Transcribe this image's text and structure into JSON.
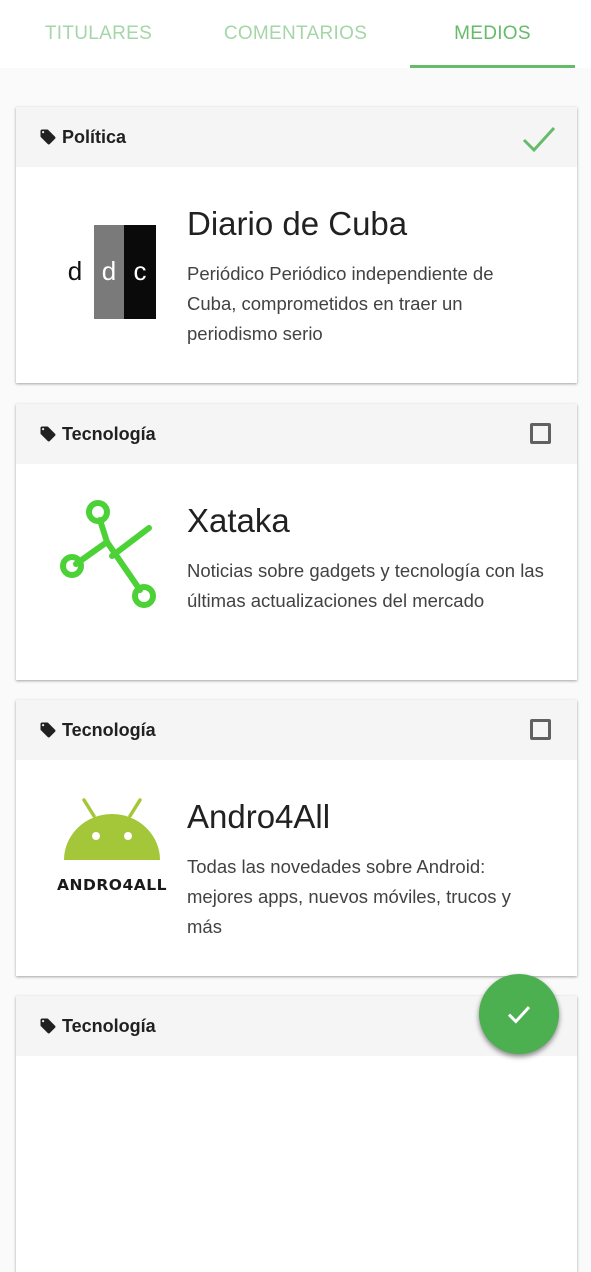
{
  "tabs": [
    {
      "label": "TITULARES",
      "active": false
    },
    {
      "label": "COMENTARIOS",
      "active": false
    },
    {
      "label": "MEDIOS",
      "active": true
    }
  ],
  "colors": {
    "accent": "#66bb6a",
    "fab": "#4caf50",
    "header_bg": "#f5f5f5"
  },
  "cards": [
    {
      "category": "Política",
      "name": "Diario de Cuba",
      "description": "Periódico Periódico independiente de Cuba, comprometidos en traer un periodismo serio",
      "selected": true,
      "logo": "ddc-logo",
      "logo_text": [
        "d",
        "d",
        "c"
      ]
    },
    {
      "category": "Tecnología",
      "name": "Xataka",
      "description": "Noticias sobre gadgets y tecnología con las últimas actualizaciones del mercado",
      "selected": false,
      "logo": "xataka-logo"
    },
    {
      "category": "Tecnología",
      "name": "Andro4All",
      "description": "Todas las novedades sobre Android: mejores apps, nuevos móviles, trucos y más",
      "selected": false,
      "logo": "andro4all-logo",
      "logo_text": "ANDRO4ALL"
    },
    {
      "category": "Tecnología",
      "selected": false
    }
  ],
  "fab": {
    "icon": "check-icon"
  }
}
